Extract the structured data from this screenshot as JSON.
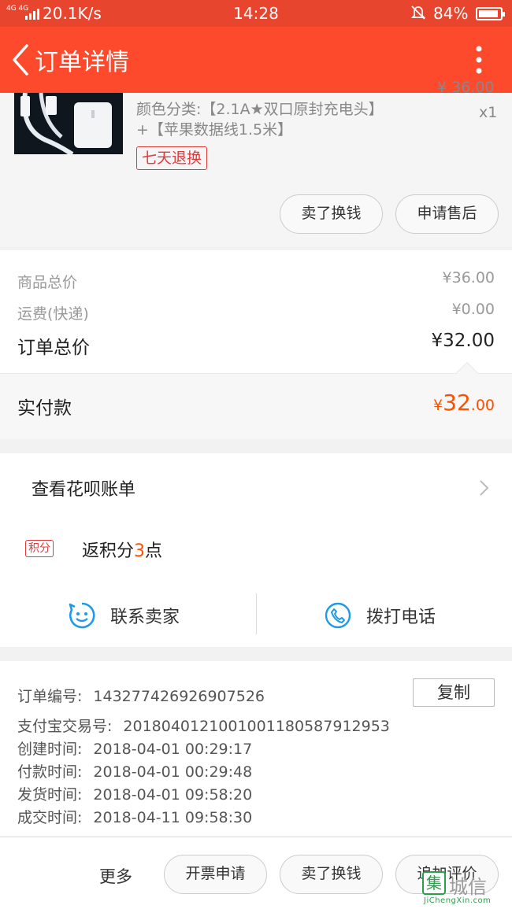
{
  "status_bar": {
    "network": "4G 4G",
    "speed": "20.1K/s",
    "time": "14:28",
    "battery": "84%"
  },
  "nav": {
    "title": "订单详情"
  },
  "product": {
    "price_partial": "¥ 36.00",
    "spec_line1": "颜色分类:【2.1A★双口原封充电头】",
    "spec_line2": "+【苹果数据线1.5米】",
    "quantity": "x1",
    "return_badge": "七天退换",
    "btn_sell": "卖了换钱",
    "btn_after_sale": "申请售后"
  },
  "prices": {
    "goods_total_label": "商品总价",
    "goods_total_value": "¥36.00",
    "shipping_label": "运费(快递)",
    "shipping_value": "¥0.00",
    "order_total_label": "订单总价",
    "order_total_value": "¥32.00",
    "paid_label": "实付款",
    "paid_yen": "¥",
    "paid_int": "32",
    "paid_dec": ".00"
  },
  "huabei": {
    "bill_label": "查看花呗账单",
    "points_tag": "积分",
    "points_prefix": "返积分",
    "points_num": "3",
    "points_suffix": "点",
    "contact_seller": "联系卖家",
    "call_phone": "拨打电话"
  },
  "order_info": {
    "copy_label": "复制",
    "rows": [
      {
        "k": "订单编号:",
        "v": "143277426926907526"
      },
      {
        "k": "支付宝交易号:",
        "v": "2018040121001001180587912953"
      },
      {
        "k": "创建时间:",
        "v": "2018-04-01 00:29:17"
      },
      {
        "k": "付款时间:",
        "v": "2018-04-01 00:29:48"
      },
      {
        "k": "发货时间:",
        "v": "2018-04-01 09:58:20"
      },
      {
        "k": "成交时间:",
        "v": "2018-04-11 09:58:30"
      }
    ]
  },
  "bottom_bar": {
    "more": "更多",
    "invoice": "开票申请",
    "sell": "卖了换钱",
    "review": "追加评价"
  },
  "watermark": {
    "logo_char": "集",
    "cn": "城信",
    "en": "JiChengXin.com"
  },
  "colors": {
    "nav_bg": "#fe4a2c",
    "accent_red": "#e4393c",
    "price_orange": "#ff5000",
    "icon_blue": "#1e9be6"
  }
}
